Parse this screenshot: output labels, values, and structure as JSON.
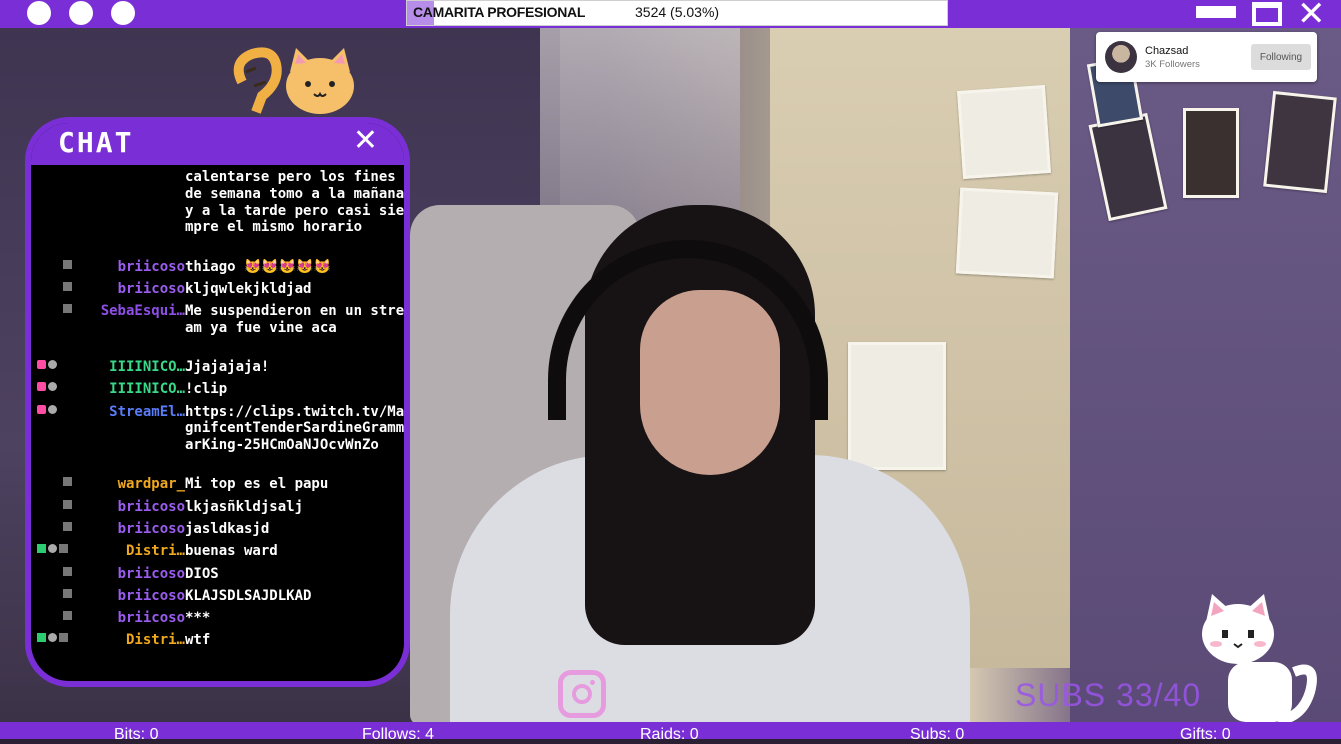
{
  "topbar": {
    "goal_label": "CAMARITA PROFESIONAL",
    "goal_count": "3524 (5.03%)",
    "goal_progress_percent": 5.03
  },
  "follow_card": {
    "name": "Chazsad",
    "followers": "3K Followers",
    "button": "Following"
  },
  "chat": {
    "title": "CHAT",
    "close": "✕",
    "messages": [
      {
        "user": "",
        "user_color": "#ffffff",
        "badges": [],
        "text": "calentarse pero los fines de semana tomo a la mañana y a la tarde pero casi siempre el mismo horario"
      },
      {
        "user": "briicoso",
        "user_color": "#9b5cf0",
        "badges": [
          "ban"
        ],
        "text": "thiago 😻😻😻😻😻"
      },
      {
        "user": "briicoso",
        "user_color": "#9b5cf0",
        "badges": [
          "ban"
        ],
        "text": "kljqwlekjkldjad"
      },
      {
        "user": "SebaEsqui…",
        "user_color": "#8f4ee8",
        "badges": [
          "ban"
        ],
        "text": "Me suspendieron en un stream ya fue vine aca"
      },
      {
        "user": "IIIINICO…",
        "user_color": "#39d98a",
        "badges": [
          "heart",
          "grey"
        ],
        "text": "Jjajajaja!"
      },
      {
        "user": "IIIINICO…",
        "user_color": "#39d98a",
        "badges": [
          "heart",
          "grey"
        ],
        "text": "!clip"
      },
      {
        "user": "StreamEl…",
        "user_color": "#5b7cf7",
        "badges": [
          "heart",
          "grey"
        ],
        "text": "https://clips.twitch.tv/MagnifcentTenderSardineGrammarKing-25HCmOaNJOcvWnZo"
      },
      {
        "user": "wardpar_",
        "user_color": "#f0a81f",
        "badges": [
          "ban"
        ],
        "text": "Mi top es el papu"
      },
      {
        "user": "briicoso",
        "user_color": "#9b5cf0",
        "badges": [
          "ban"
        ],
        "text": "lkjasñkldjsalj"
      },
      {
        "user": "briicoso",
        "user_color": "#9b5cf0",
        "badges": [
          "ban"
        ],
        "text": "jasldkasjd"
      },
      {
        "user": "Distri…",
        "user_color": "#f0a81f",
        "badges": [
          "green",
          "grey",
          "ban"
        ],
        "text": "buenas ward"
      },
      {
        "user": "briicoso",
        "user_color": "#9b5cf0",
        "badges": [
          "ban"
        ],
        "text": "DIOS"
      },
      {
        "user": "briicoso",
        "user_color": "#9b5cf0",
        "badges": [
          "ban"
        ],
        "text": "KLAJSDLSAJDLKAD"
      },
      {
        "user": "briicoso",
        "user_color": "#9b5cf0",
        "badges": [
          "ban"
        ],
        "text": "***"
      },
      {
        "user": "Distri…",
        "user_color": "#f0a81f",
        "badges": [
          "green",
          "grey",
          "ban"
        ],
        "text": "wtf"
      }
    ]
  },
  "overlay": {
    "subs_goal": "SUBS 33/40",
    "instagram_icon": "instagram-icon"
  },
  "stats": {
    "bits": "Bits: 0",
    "follows": "Follows: 4",
    "raids": "Raids: 0",
    "subs": "Subs: 0",
    "gifts": "Gifts: 0"
  },
  "colors": {
    "accent": "#7a2fd6",
    "chat_bg": "#000000",
    "instagram": "#e79bdf"
  }
}
